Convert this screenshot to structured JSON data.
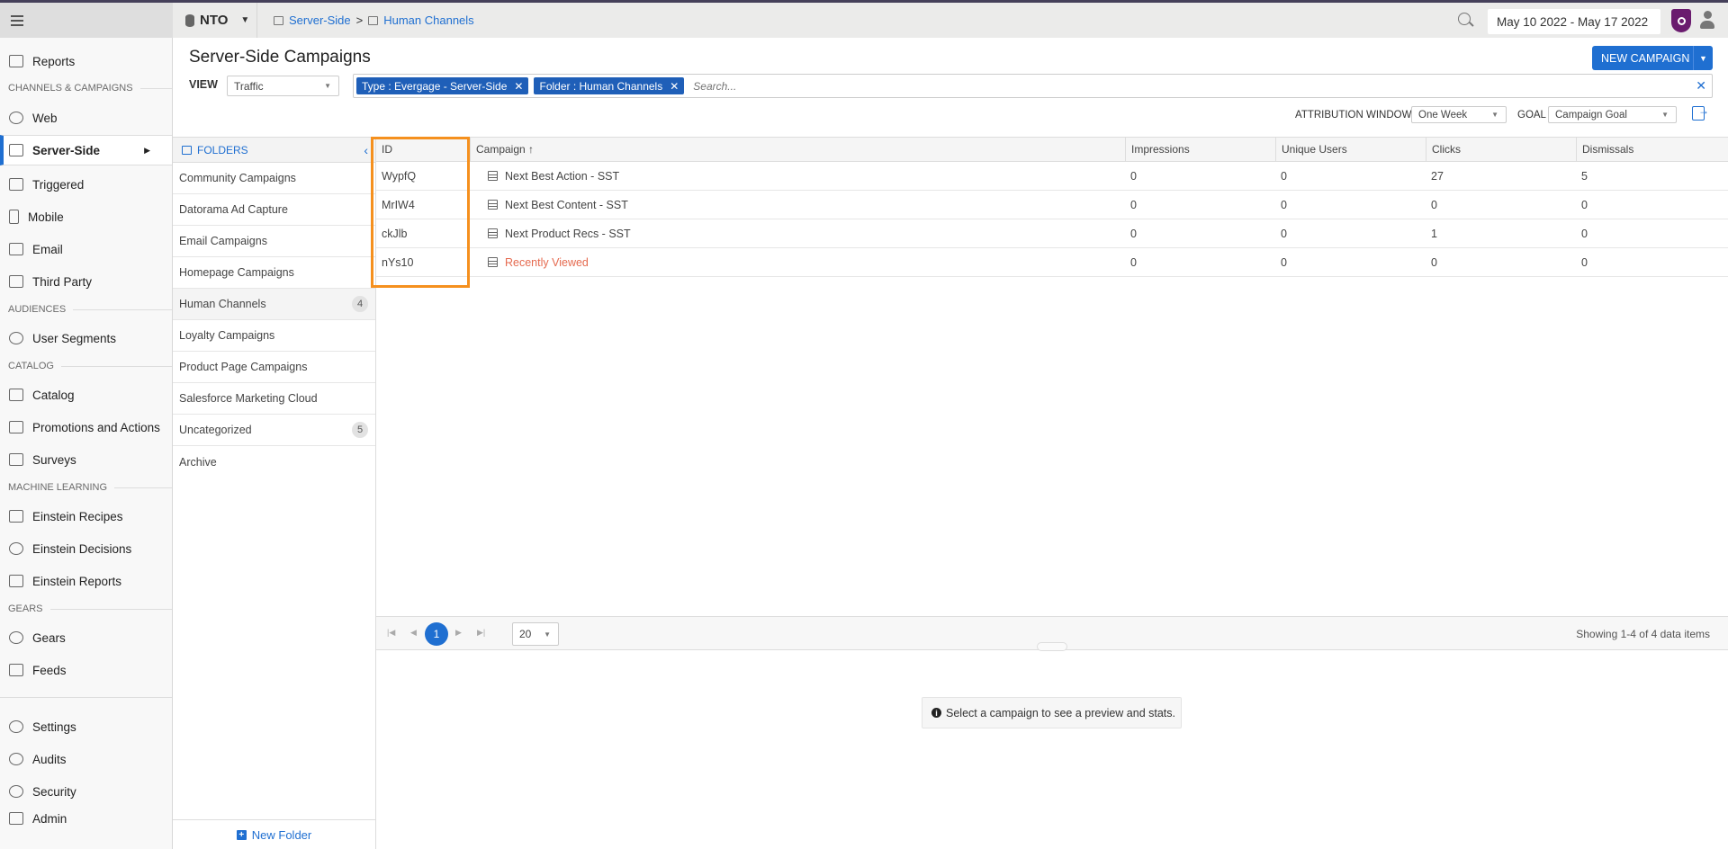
{
  "topbar": {
    "account": "NTO",
    "breadcrumb": [
      "Server-Side",
      "Human Channels"
    ],
    "breadcrumb_sep": ">",
    "date_range": "May 10 2022 - May 17 2022"
  },
  "nav": {
    "items": [
      {
        "label": "Reports",
        "icon": "reports-icon"
      },
      {
        "section": "CHANNELS & CAMPAIGNS"
      },
      {
        "label": "Web",
        "icon": "globe-icon"
      },
      {
        "label": "Server-Side",
        "icon": "server-icon",
        "active": true
      },
      {
        "label": "Triggered",
        "icon": "share-icon"
      },
      {
        "label": "Mobile",
        "icon": "mobile-icon"
      },
      {
        "label": "Email",
        "icon": "email-icon"
      },
      {
        "label": "Third Party",
        "icon": "cubes-icon"
      },
      {
        "section": "AUDIENCES"
      },
      {
        "label": "User Segments",
        "icon": "users-icon"
      },
      {
        "section": "CATALOG"
      },
      {
        "label": "Catalog",
        "icon": "book-icon"
      },
      {
        "label": "Promotions and Actions",
        "icon": "images-icon"
      },
      {
        "label": "Surveys",
        "icon": "clipboard-icon"
      },
      {
        "section": "MACHINE LEARNING"
      },
      {
        "label": "Einstein Recipes",
        "icon": "list-icon"
      },
      {
        "label": "Einstein Decisions",
        "icon": "atom-icon"
      },
      {
        "label": "Einstein Reports",
        "icon": "report-file-icon"
      },
      {
        "section": "GEARS"
      },
      {
        "label": "Gears",
        "icon": "gears-icon"
      },
      {
        "label": "Feeds",
        "icon": "feed-file-icon"
      },
      {
        "label": "Settings",
        "icon": "gear-icon"
      },
      {
        "label": "Audits",
        "icon": "history-icon"
      },
      {
        "label": "Security",
        "icon": "key-icon"
      },
      {
        "label": "Admin",
        "icon": "lock-icon"
      }
    ]
  },
  "page": {
    "title": "Server-Side Campaigns",
    "new_campaign": "NEW CAMPAIGN",
    "view_label": "VIEW",
    "view_value": "Traffic",
    "filters": [
      "Type : Evergage - Server-Side",
      "Folder : Human Channels"
    ],
    "search_placeholder": "Search...",
    "attribution_label": "ATTRIBUTION WINDOW",
    "attribution_value": "One Week",
    "goal_label": "GOAL",
    "goal_value": "Campaign Goal"
  },
  "folders": {
    "header": "FOLDERS",
    "items": [
      {
        "name": "Community Campaigns"
      },
      {
        "name": "Datorama Ad Capture"
      },
      {
        "name": "Email Campaigns"
      },
      {
        "name": "Homepage Campaigns"
      },
      {
        "name": "Human Channels",
        "count": "4",
        "selected": true
      },
      {
        "name": "Loyalty Campaigns"
      },
      {
        "name": "Product Page Campaigns"
      },
      {
        "name": "Salesforce Marketing Cloud"
      },
      {
        "name": "Uncategorized",
        "count": "5"
      },
      {
        "name": "Archive"
      }
    ],
    "new_folder": "New Folder"
  },
  "table": {
    "columns": [
      "ID",
      "Campaign",
      "Impressions",
      "Unique Users",
      "Clicks",
      "Dismissals"
    ],
    "sort_indicator": "↑",
    "rows": [
      {
        "id": "WypfQ",
        "campaign": "Next Best Action - SST",
        "impressions": "0",
        "unique_users": "0",
        "clicks": "27",
        "dismissals": "5"
      },
      {
        "id": "MrIW4",
        "campaign": "Next Best Content - SST",
        "impressions": "0",
        "unique_users": "0",
        "clicks": "0",
        "dismissals": "0"
      },
      {
        "id": "ckJlb",
        "campaign": "Next Product Recs - SST",
        "impressions": "0",
        "unique_users": "0",
        "clicks": "1",
        "dismissals": "0"
      },
      {
        "id": "nYs10",
        "campaign": "Recently Viewed",
        "impressions": "0",
        "unique_users": "0",
        "clicks": "0",
        "dismissals": "0",
        "warning": true
      }
    ]
  },
  "pager": {
    "current_page": "1",
    "page_size": "20",
    "showing": "Showing 1-4 of 4 data items"
  },
  "preview": {
    "message": "Select a campaign to see a preview and stats."
  },
  "colors": {
    "accent": "#1f6fd1",
    "highlight": "#f5901e",
    "warning_text": "#e56a4f"
  }
}
